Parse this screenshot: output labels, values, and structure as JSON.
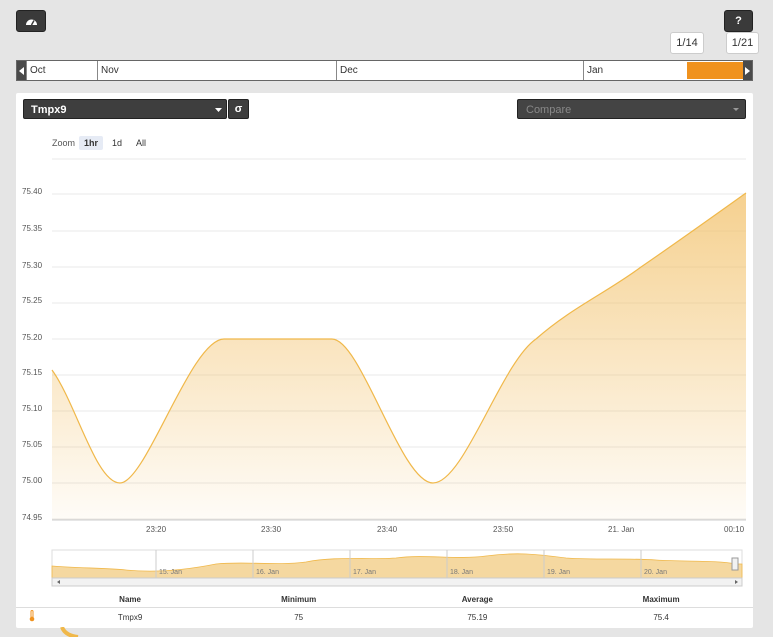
{
  "toolbar": {
    "dashboard_icon": "dashboard-gauge-icon",
    "help_label": "?"
  },
  "timeline": {
    "start_tip": "1/14",
    "end_tip": "1/21",
    "months": [
      "Oct",
      "Nov",
      "Dec",
      "Jan"
    ]
  },
  "series_select": {
    "value": "Tmpx9",
    "sigma_label": "σ"
  },
  "compare_select": {
    "placeholder": "Compare"
  },
  "zoom": {
    "label": "Zoom",
    "options": [
      "1hr",
      "1d",
      "All"
    ],
    "selected": "1hr"
  },
  "chart_data": {
    "type": "area",
    "color": "#f0b84a",
    "y_ticks": [
      "74.95",
      "75.00",
      "75.05",
      "75.10",
      "75.15",
      "75.20",
      "75.25",
      "75.30",
      "75.35",
      "75.40"
    ],
    "ylim": [
      74.95,
      75.45
    ],
    "x_ticks": [
      "23:20",
      "23:30",
      "23:40",
      "23:50",
      "21. Jan",
      "00:10"
    ],
    "series": [
      {
        "points": [
          [
            "23:11",
            75.16
          ],
          [
            "23:17",
            75.0
          ],
          [
            "23:26",
            75.2
          ],
          [
            "23:36",
            75.2
          ],
          [
            "23:44",
            75.0
          ],
          [
            "23:52",
            75.2
          ],
          [
            "00:00",
            75.3
          ],
          [
            "00:11",
            75.4
          ]
        ]
      }
    ],
    "navigator": {
      "labels": [
        "15. Jan",
        "16. Jan",
        "17. Jan",
        "18. Jan",
        "19. Jan",
        "20. Jan"
      ]
    }
  },
  "stats": {
    "headers": [
      "Name",
      "Minimum",
      "Average",
      "Maximum"
    ],
    "row": {
      "icon": "thermometer-icon",
      "name": "Tmpx9",
      "minimum": "75",
      "average": "75.19",
      "maximum": "75.4"
    }
  }
}
